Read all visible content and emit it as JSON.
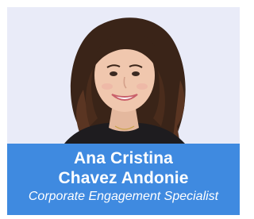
{
  "profile": {
    "name_line1": "Ana Cristina",
    "name_line2": "Chavez Andonie",
    "title": "Corporate Engagement Specialist",
    "photo_icon": "portrait-photo"
  },
  "colors": {
    "card_background": "#e9ebf8",
    "caption_background": "#3f8ae0",
    "caption_text": "#ffffff"
  }
}
